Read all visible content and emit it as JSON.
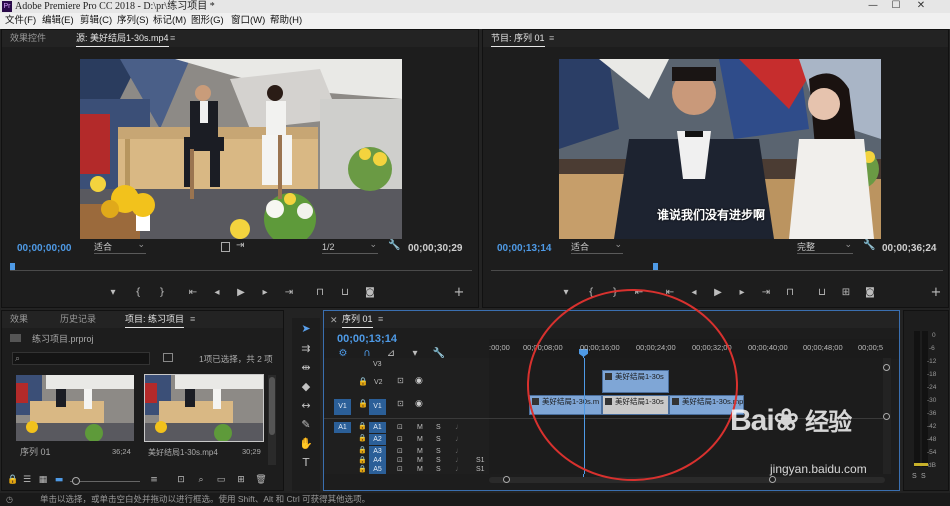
{
  "window": {
    "title": "Adobe Premiere Pro CC 2018 - D:\\pr\\练习项目 *",
    "app_icon": "Pr",
    "minimize": "—",
    "maximize": "☐",
    "close": "✕"
  },
  "menu": [
    "文件(F)",
    "编辑(E)",
    "剪辑(C)",
    "序列(S)",
    "标记(M)",
    "图形(G)",
    "窗口(W)",
    "帮助(H)"
  ],
  "source_monitor": {
    "tabs": [
      "效果控件",
      "源: 美好结局1-30s.mp4"
    ],
    "timecode_left": "00;00;00;00",
    "fit": "适合",
    "resolution": "1/2",
    "timecode_right": "00;00;30;29"
  },
  "program_monitor": {
    "tab": "节目: 序列 01",
    "subtitle": "谁说我们没有进步啊",
    "timecode_left": "00;00;13;14",
    "fit": "适合",
    "quality": "完整",
    "timecode_right": "00;00;36;24"
  },
  "project": {
    "tabs": [
      "效果",
      "历史记录",
      "项目: 练习项目"
    ],
    "file": "练习项目.prproj",
    "selection_info": "1项已选择，共 2 项",
    "items": [
      {
        "name": "序列 01",
        "duration": "36;24"
      },
      {
        "name": "美好结局1-30s.mp4",
        "duration": "30;29"
      }
    ]
  },
  "timeline": {
    "tab": "序列 01",
    "timecode": "00;00;13;14",
    "ruler": [
      ":00;00",
      "00;00;08;00",
      "00;00;16;00",
      "00;00;24;00",
      "00;00;32;00",
      "00;00;40;00",
      "00;00;48;00",
      "00;00;5"
    ],
    "tracks": [
      "V3",
      "V2",
      "V1",
      "A1",
      "A2",
      "A3",
      "A4",
      "A5"
    ],
    "source_v": "V1",
    "source_a": "A1",
    "m": "M",
    "s": "S",
    "s1": "S1",
    "clips": {
      "v2": "美好结局1-30s",
      "v1a": "美好结局1-30s.m",
      "v1b": "美好结局1-30s",
      "v1c": "美好结局1-30s.mp"
    }
  },
  "meter": [
    "0",
    "-6",
    "-12",
    "-18",
    "-24",
    "-30",
    "-36",
    "-42",
    "-48",
    "-54",
    "dB"
  ],
  "statusbar": "单击以选择，或单击空白处并拖动以进行框选。使用 Shift、Alt 和 Ctrl 可获得其他选项。",
  "watermark": {
    "brand": "Bai",
    "brand2": "经验",
    "url": "jingyan.baidu.com"
  }
}
